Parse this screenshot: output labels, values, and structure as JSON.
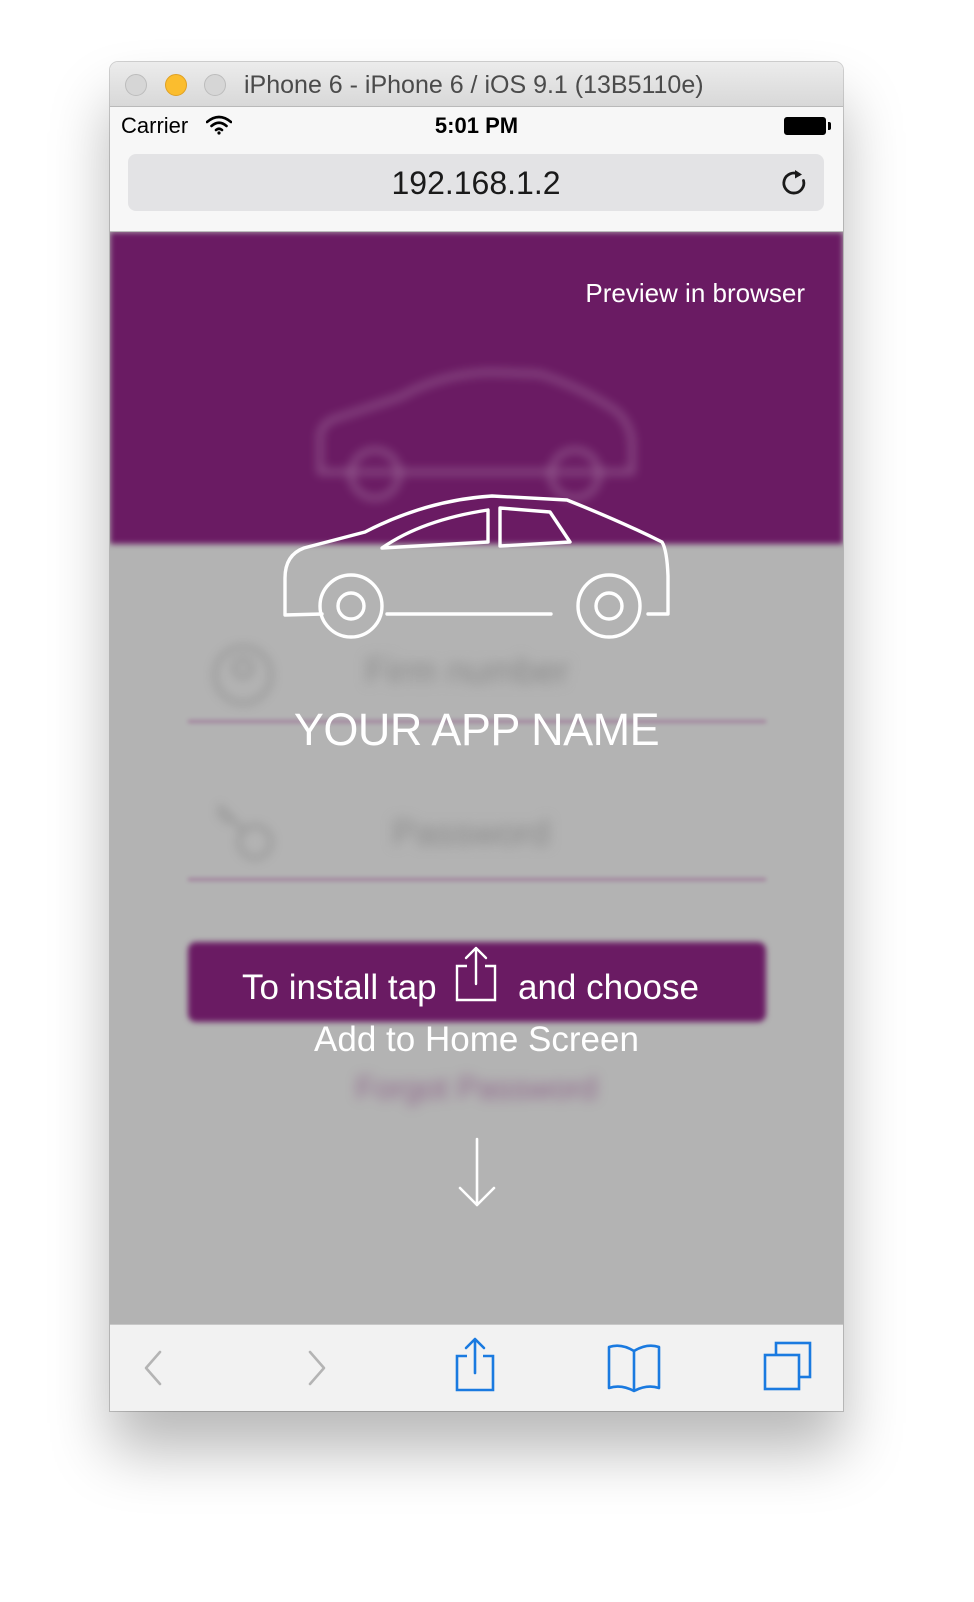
{
  "window": {
    "title": "iPhone 6 - iPhone 6 / iOS 9.1 (13B5110e)"
  },
  "status": {
    "carrier": "Carrier",
    "time": "5:01 PM"
  },
  "browser": {
    "url": "192.168.1.2"
  },
  "page": {
    "preview_link": "Preview in browser",
    "app_name": "YOUR APP NAME",
    "install_text_before": "To install tap",
    "install_text_after": "and choose",
    "install_text_line2": "Add to Home Screen",
    "bg_field_1": "Firm number",
    "bg_field_2": "Password",
    "bg_forgot": "Forgot Password"
  },
  "colors": {
    "brand_purple": "#6a1b63",
    "overlay_gray": "#b3b3b3",
    "ios_blue": "#1a7ae0"
  },
  "toolbar": {
    "icons": [
      "back-icon",
      "forward-icon",
      "share-icon",
      "bookmarks-icon",
      "tabs-icon"
    ]
  }
}
